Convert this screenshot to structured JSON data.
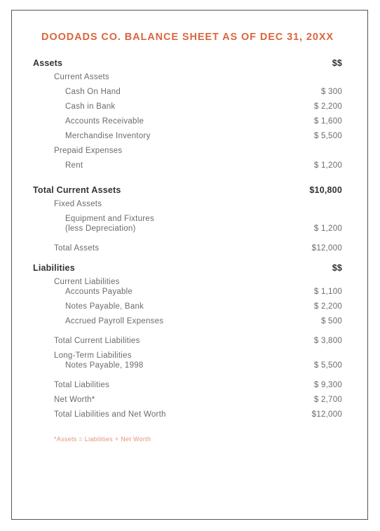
{
  "document": {
    "title": "DOODADS CO. BALANCE SHEET AS OF DEC 31, 20XX",
    "footnote": "*Assets = Liabilities + Net Worth",
    "accent_color": "#d9663f",
    "footnote_color": "#e6937a",
    "body_text_color": "#6b6b6b",
    "heading_text_color": "#333333",
    "border_color": "#555555",
    "background_color": "#ffffff"
  },
  "rows": [
    {
      "label": "Assets",
      "value": "$$",
      "indent": 0,
      "style": "section-head",
      "gap": "none"
    },
    {
      "label": "Current Assets",
      "value": "",
      "indent": 1,
      "style": "normal",
      "gap": "none"
    },
    {
      "label": "Cash On Hand",
      "value": "$ 300",
      "indent": 2,
      "style": "normal",
      "gap": "none"
    },
    {
      "label": "Cash in Bank",
      "value": "$ 2,200",
      "indent": 2,
      "style": "normal",
      "gap": "none"
    },
    {
      "label": "Accounts Receivable",
      "value": "$ 1,600",
      "indent": 2,
      "style": "normal",
      "gap": "none"
    },
    {
      "label": "Merchandise Inventory",
      "value": "$ 5,500",
      "indent": 2,
      "style": "normal",
      "gap": "none"
    },
    {
      "label": "Prepaid Expenses",
      "value": "",
      "indent": 1,
      "style": "normal",
      "gap": "none"
    },
    {
      "label": "Rent",
      "value": "$ 1,200",
      "indent": 2,
      "style": "normal",
      "gap": "none"
    },
    {
      "label": "Total Current Assets",
      "value": "$10,800",
      "indent": 0,
      "style": "total-strong",
      "gap": "large"
    },
    {
      "label": "Fixed Assets",
      "value": "",
      "indent": 1,
      "style": "normal",
      "gap": "small"
    },
    {
      "label": "Equipment and Fixtures",
      "value": "",
      "indent": 2,
      "style": "normal",
      "gap": "small"
    },
    {
      "label": "(less Depreciation)",
      "value": "$ 1,200",
      "indent": 2,
      "style": "normal",
      "gap": "none"
    },
    {
      "label": "Total Assets",
      "value": "$12,000",
      "indent": 1,
      "style": "normal",
      "gap": "small"
    },
    {
      "label": "Liabilities",
      "value": "$$",
      "indent": 0,
      "style": "section-head",
      "gap": "large"
    },
    {
      "label": "Current Liabilities",
      "value": "",
      "indent": 1,
      "style": "normal",
      "gap": "small"
    },
    {
      "label": "Accounts Payable",
      "value": "$ 1,100",
      "indent": 2,
      "style": "normal",
      "gap": "none"
    },
    {
      "label": "Notes Payable, Bank",
      "value": "$ 2,200",
      "indent": 2,
      "style": "normal",
      "gap": "none"
    },
    {
      "label": "Accrued Payroll Expenses",
      "value": "$ 500",
      "indent": 2,
      "style": "normal",
      "gap": "none"
    },
    {
      "label": "Total Current Liabilities",
      "value": "$ 3,800",
      "indent": 1,
      "style": "normal",
      "gap": "small"
    },
    {
      "label": "Long-Term Liabilities",
      "value": "",
      "indent": 1,
      "style": "normal",
      "gap": "small"
    },
    {
      "label": "Notes Payable, 1998",
      "value": "$ 5,500",
      "indent": 2,
      "style": "normal",
      "gap": "none"
    },
    {
      "label": "Total Liabilities",
      "value": "$ 9,300",
      "indent": 1,
      "style": "normal",
      "gap": "small"
    },
    {
      "label": "Net Worth*",
      "value": "$ 2,700",
      "indent": 1,
      "style": "normal",
      "gap": "small"
    },
    {
      "label": "Total Liabilities and Net Worth",
      "value": "$12,000",
      "indent": 1,
      "style": "normal",
      "gap": "small"
    }
  ]
}
